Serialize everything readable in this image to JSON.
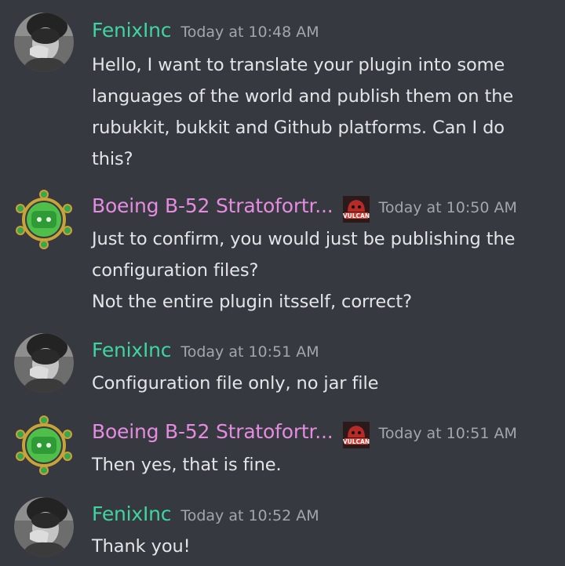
{
  "colors": {
    "background": "#36393f",
    "fenix_name": "#3fd4a0",
    "boeing_name": "#e58ce0",
    "timestamp": "#a3a6aa",
    "text": "#e3e5e8"
  },
  "messages": [
    {
      "author": "FenixInc",
      "timestamp": "Today at 10:48 AM",
      "lines": [
        "Hello, I want to translate your plugin into some",
        "languages of the world and publish them on the",
        "rubukkit, bukkit and Github platforms. Can I do",
        "this?"
      ]
    },
    {
      "author": "Boeing B-52 Stratofortr...",
      "badge_icon": "vulcan-badge-icon",
      "badge_text": "VULCAN",
      "timestamp": "Today at 10:50 AM",
      "lines": [
        "Just to confirm, you would just be publishing the",
        "configuration files?",
        "Not the entire plugin itsself, correct?"
      ]
    },
    {
      "author": "FenixInc",
      "timestamp": "Today at 10:51 AM",
      "lines": [
        "Configuration file only, no jar file"
      ]
    },
    {
      "author": "Boeing B-52 Stratofortr...",
      "badge_icon": "vulcan-badge-icon",
      "badge_text": "VULCAN",
      "timestamp": "Today at 10:51 AM",
      "lines": [
        "Then yes, that is fine."
      ]
    },
    {
      "author": "FenixInc",
      "timestamp": "Today at 10:52 AM",
      "lines": [
        "Thank you!"
      ]
    }
  ]
}
